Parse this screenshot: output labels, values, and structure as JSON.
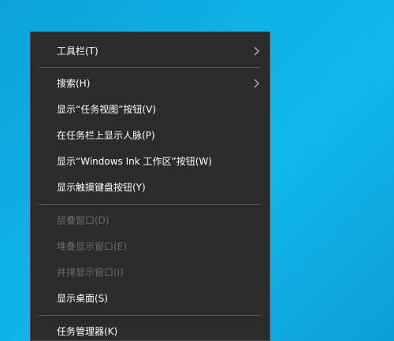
{
  "context_menu": {
    "items": [
      {
        "label": "工具栏(T)"
      },
      {
        "label": "搜索(H)"
      },
      {
        "label": "显示“任务视图”按钮(V)"
      },
      {
        "label": "在任务栏上显示人脉(P)"
      },
      {
        "label": "显示“Windows Ink 工作区”按钮(W)"
      },
      {
        "label": "显示触摸键盘按钮(Y)"
      },
      {
        "label": "层叠窗口(D)"
      },
      {
        "label": "堆叠显示窗口(E)"
      },
      {
        "label": "并排显示窗口(I)"
      },
      {
        "label": "显示桌面(S)"
      },
      {
        "label": "任务管理器(K)"
      }
    ]
  },
  "colors": {
    "menu_background": "#2b2b2b",
    "text": "#ffffff",
    "disabled_text": "#6d6d6d",
    "separator": "#5b5b5b",
    "desktop": "#0fb0e6"
  },
  "icons": {
    "submenu": "chevron-right-icon"
  }
}
